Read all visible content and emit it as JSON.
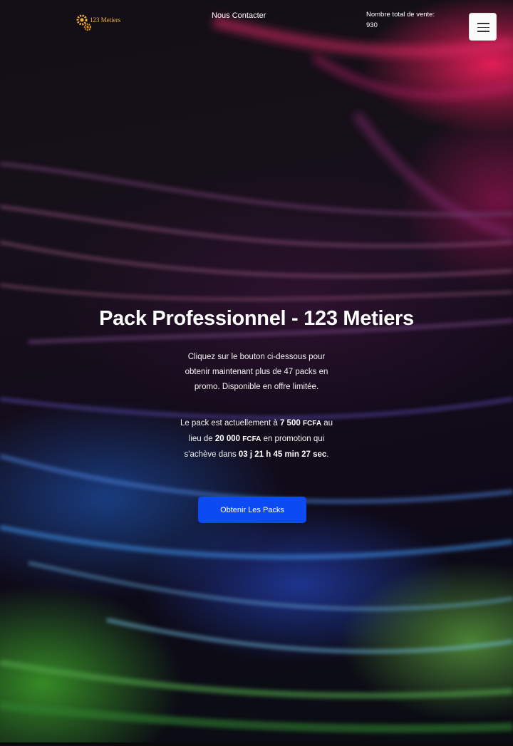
{
  "header": {
    "logo_text": "123 Metiers",
    "contact_link": "Nous Contacter",
    "sales_counter": "Nombre total de vente: 930",
    "menu_icon": "hamburger-menu-icon"
  },
  "hero": {
    "title": "Pack Professionnel - 123 Metiers",
    "description": "Cliquez sur le bouton ci-dessous pour obtenir maintenant plus de 47 packs en promo. Disponible en offre limitée.",
    "price_prefix": "Le pack est actuellement à",
    "promo_amount": "7 500",
    "currency": "FCFA",
    "price_middle": "au lieu de",
    "original_amount": "20 000",
    "promo_suffix": "en promotion qui s'achève dans",
    "countdown": "03 j 21 h 45 min 27 sec",
    "price_end": ".",
    "cta_label": "Obtenir Les Packs"
  },
  "colors": {
    "cta_background": "#0d4bf2",
    "logo_gold": "#f3b23a",
    "text": "#ffffff"
  }
}
